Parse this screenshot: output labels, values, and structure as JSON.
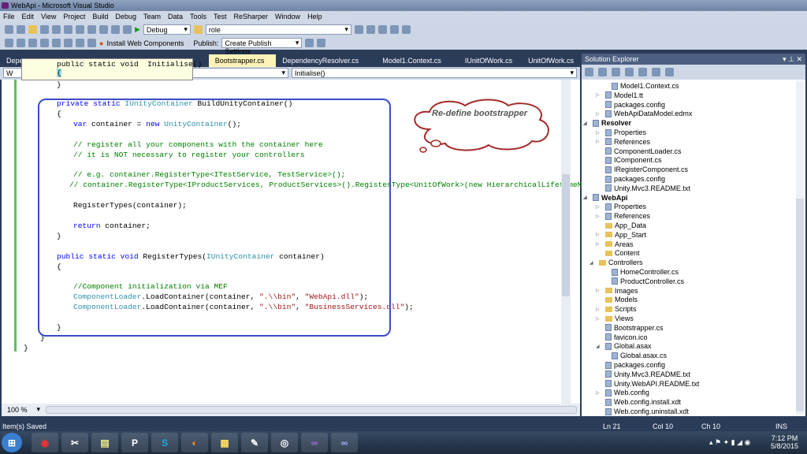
{
  "window": {
    "title": "WebApi - Microsoft Visual Studio"
  },
  "menu": [
    "File",
    "Edit",
    "View",
    "Project",
    "Build",
    "Debug",
    "Team",
    "Data",
    "Tools",
    "Test",
    "ReSharper",
    "Window",
    "Help"
  ],
  "toolbar": {
    "config": "Debug",
    "find": "role",
    "install_web_components": "Install Web Components",
    "publish_label": "Publish:",
    "publish_value": "Create Publish Settings"
  },
  "tabs": [
    "Depe",
    "Bootstrapper.cs",
    "DependencyResolver.cs",
    "Model1.Context.cs",
    "IUnitOfWork.cs",
    "UnitOfWork.cs"
  ],
  "tab_close": "×",
  "navbar": {
    "left": "W",
    "right": "Initialise()"
  },
  "tooltip": {
    "line1": "public static void  Initialise()",
    "line2": "{"
  },
  "code": [
    "}",
    "private static IUnityContainer BuildUnityContainer()",
    "{",
    "var container = new UnityContainer();",
    "// register all your components with the container here",
    "// it is NOT necessary to register your controllers",
    "// e.g. container.RegisterType<ITestService, TestService>();",
    "// container.RegisterType<IProductServices, ProductServices>().RegisterType<UnitOfWork>(new HierarchicalLifetimeManag",
    "RegisterTypes(container);",
    "return container;",
    "}",
    "public static void RegisterTypes(IUnityContainer container)",
    "{",
    "//Component initialization via MEF",
    "ComponentLoader.LoadContainer(container, \".\\\\bin\", \"WebApi.dll\");",
    "ComponentLoader.LoadContainer(container, \".\\\\bin\", \"BusinessServices.dll\");",
    "}",
    "}",
    "}"
  ],
  "callout": "Re-define bootstrapper",
  "zoom": "100 %",
  "solution_explorer": {
    "title": "Solution Explorer",
    "items": [
      "Model1.Context.cs",
      "Model1.tt",
      "packages.config",
      "WebApiDataModel.edmx",
      "Resolver",
      "Properties",
      "References",
      "ComponentLoader.cs",
      "IComponent.cs",
      "IRegisterComponent.cs",
      "packages.config",
      "Unity.Mvc3.README.txt",
      "WebApi",
      "Properties",
      "References",
      "App_Data",
      "App_Start",
      "Areas",
      "Content",
      "Controllers",
      "HomeController.cs",
      "ProductController.cs",
      "Images",
      "Models",
      "Scripts",
      "Views",
      "Bootstrapper.cs",
      "favicon.ico",
      "Global.asax",
      "Global.asax.cs",
      "packages.config",
      "Unity.Mvc3.README.txt",
      "Unity.WebAPI.README.txt",
      "Web.config",
      "Web.config.install.xdt",
      "Web.config.uninstall.xdt"
    ]
  },
  "status": {
    "message": "Item(s) Saved",
    "ln": "Ln 21",
    "col": "Col 10",
    "ch": "Ch 10",
    "mode": "INS"
  },
  "clock": {
    "time": "7:12 PM",
    "date": "5/8/2015"
  },
  "colors": {
    "accent": "#2b3c59",
    "selection_box": "#3b4bc6",
    "keyword": "#0000ff",
    "type": "#2b91af",
    "comment": "#008000",
    "string": "#a31515"
  }
}
